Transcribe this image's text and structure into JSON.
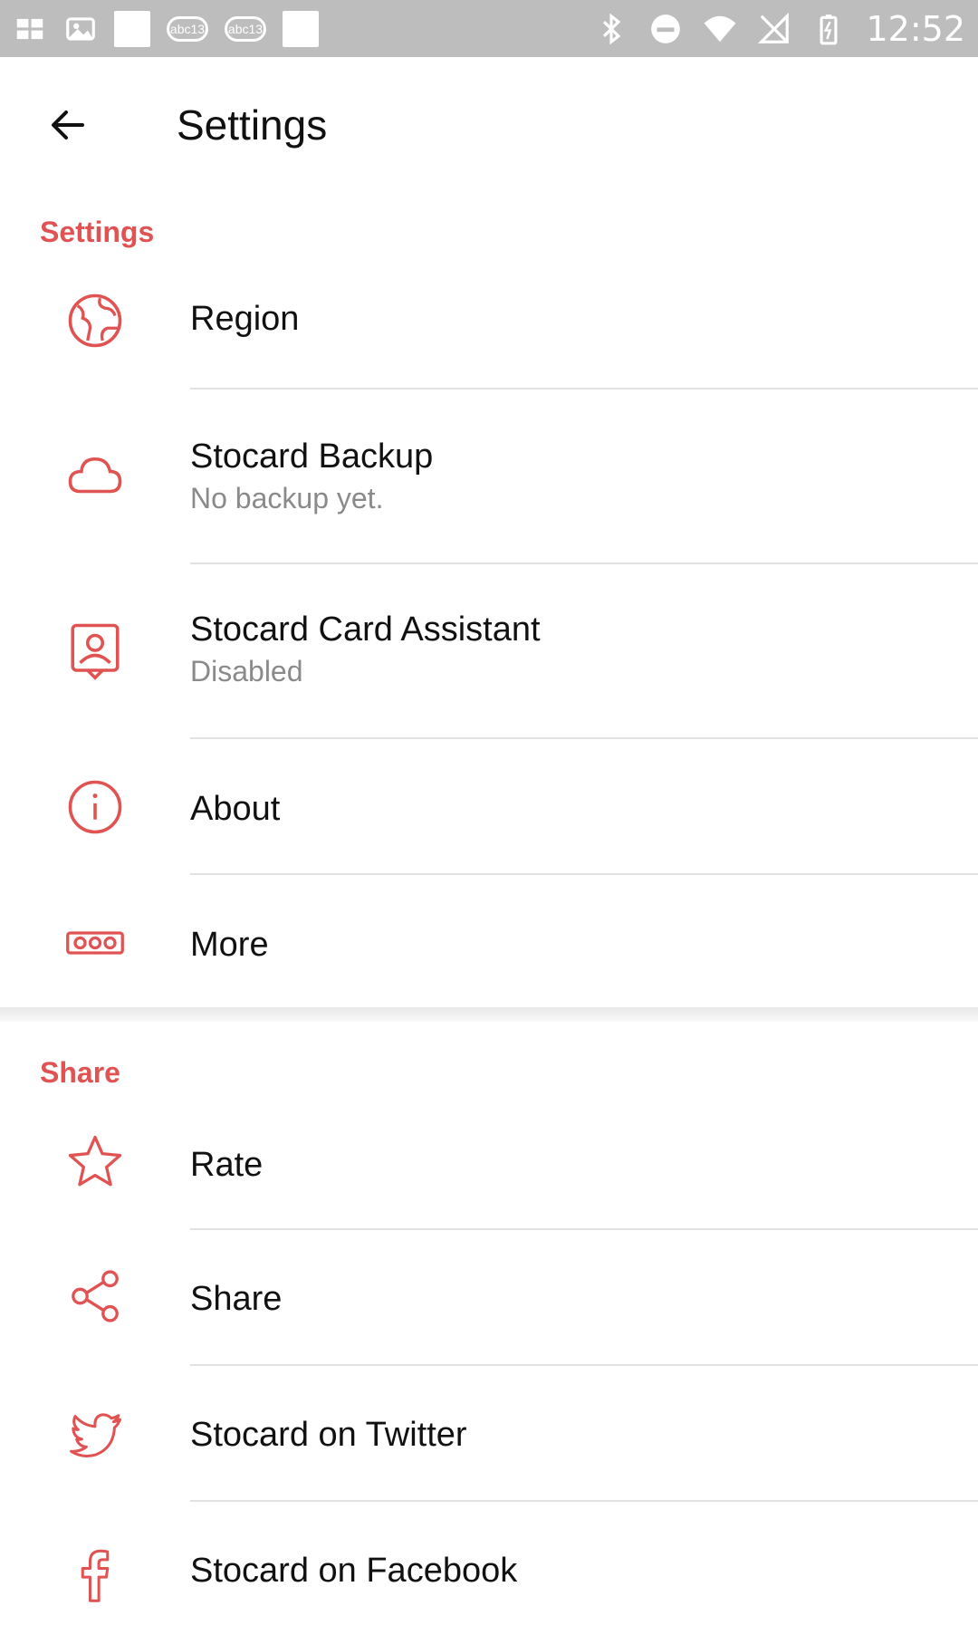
{
  "status_bar": {
    "time": "12:52",
    "notification_badges": [
      "abc13",
      "abc13"
    ],
    "icons": [
      "gallery-icon",
      "photo-icon",
      "notification-icon",
      "bluetooth-icon",
      "dnd-icon",
      "wifi-icon",
      "no-sim-icon",
      "battery-icon"
    ]
  },
  "toolbar": {
    "title": "Settings",
    "back_icon": "arrow-left-icon"
  },
  "sections": {
    "settings": {
      "header": "Settings",
      "items": [
        {
          "title": "Region",
          "subtitle": "",
          "icon": "globe-icon"
        },
        {
          "title": "Stocard Backup",
          "subtitle": "No backup yet.",
          "icon": "cloud-icon"
        },
        {
          "title": "Stocard Card Assistant",
          "subtitle": "Disabled",
          "icon": "assistant-icon"
        },
        {
          "title": "About",
          "subtitle": "",
          "icon": "info-icon"
        },
        {
          "title": "More",
          "subtitle": "",
          "icon": "more-icon"
        }
      ]
    },
    "share": {
      "header": "Share",
      "items": [
        {
          "title": "Rate",
          "icon": "star-icon"
        },
        {
          "title": "Share",
          "icon": "share-icon"
        },
        {
          "title": "Stocard on Twitter",
          "icon": "twitter-icon"
        },
        {
          "title": "Stocard on Facebook",
          "icon": "facebook-icon"
        }
      ]
    }
  },
  "colors": {
    "accent": "#e05352",
    "status_bar": "#bdbdbd",
    "subtitle": "#8a8a8a"
  }
}
